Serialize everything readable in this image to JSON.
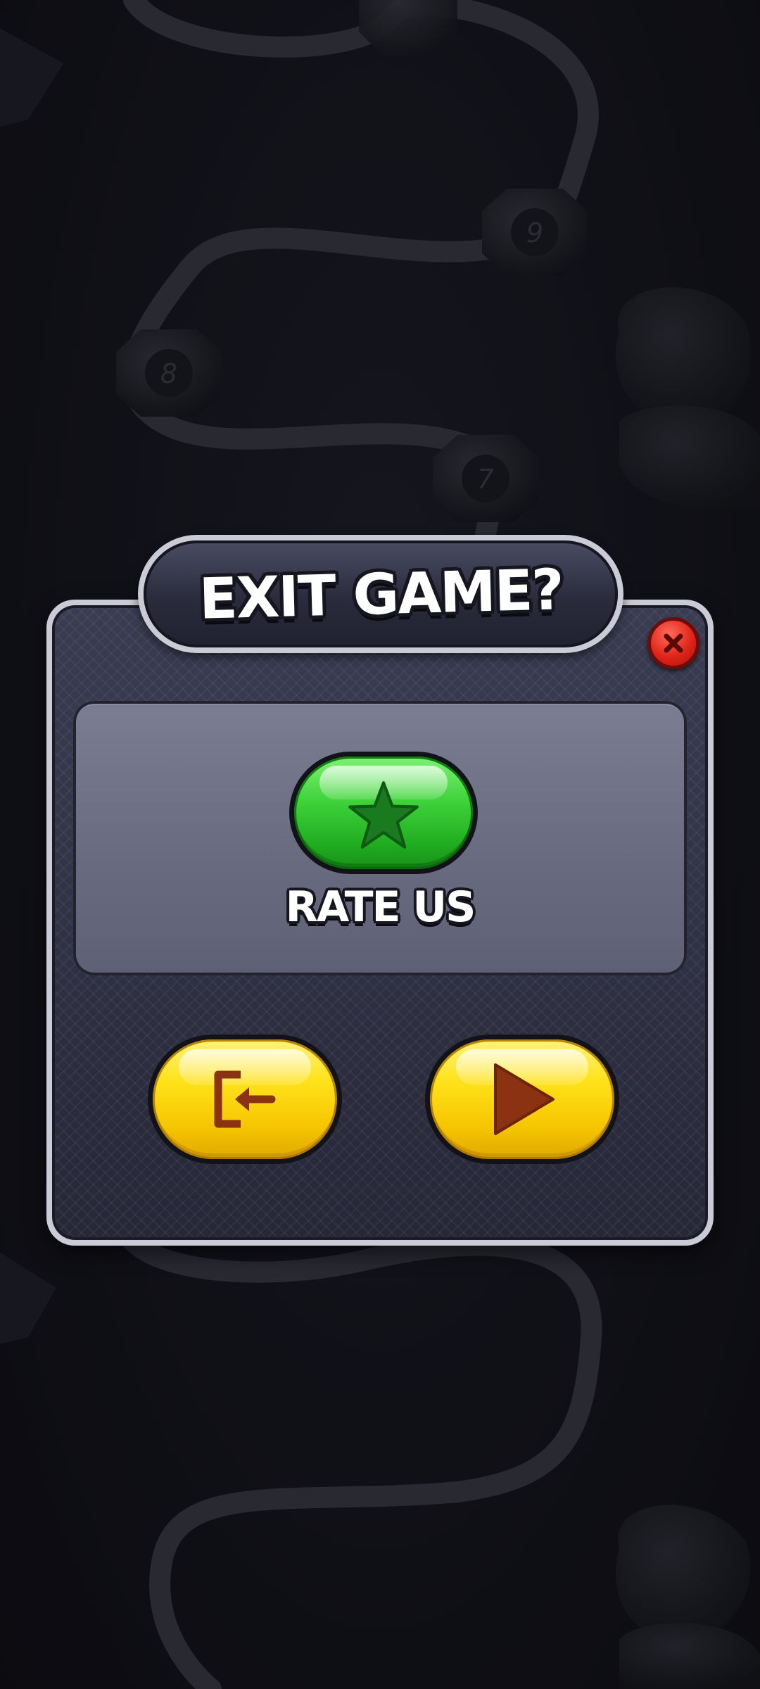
{
  "dialog": {
    "title": "EXIT GAME?",
    "rate_label": "RATE US"
  },
  "buttons": {
    "close_icon": "close-x-icon",
    "rate_icon": "star-icon",
    "exit_icon": "exit-door-icon",
    "play_icon": "play-icon"
  },
  "background": {
    "level_nodes": [
      "9",
      "8",
      "7"
    ]
  },
  "colors": {
    "rate_button": "#3fd23a",
    "exit_button": "#ffe21a",
    "play_button": "#ffe21a",
    "close_button": "#e0251a",
    "icon_brown": "#8a3212"
  }
}
